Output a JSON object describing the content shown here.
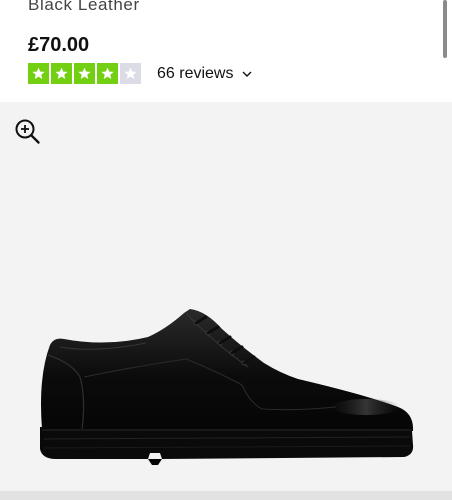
{
  "product": {
    "color_name": "Black Leather",
    "price": "£70.00",
    "rating": {
      "stars": 4,
      "out_of": 5,
      "filled_color": "#73cf11",
      "empty_color": "#dcdce6"
    },
    "reviews_label": "66 reviews"
  },
  "gallery": {
    "background": "#f3f3f3",
    "zoom_icon": "zoom-in-icon",
    "image_alt": "black leather lace-up derby shoe, side view"
  },
  "icons": {
    "star": "star-icon",
    "chevron": "chevron-down-icon",
    "zoom": "zoom-in-icon"
  }
}
